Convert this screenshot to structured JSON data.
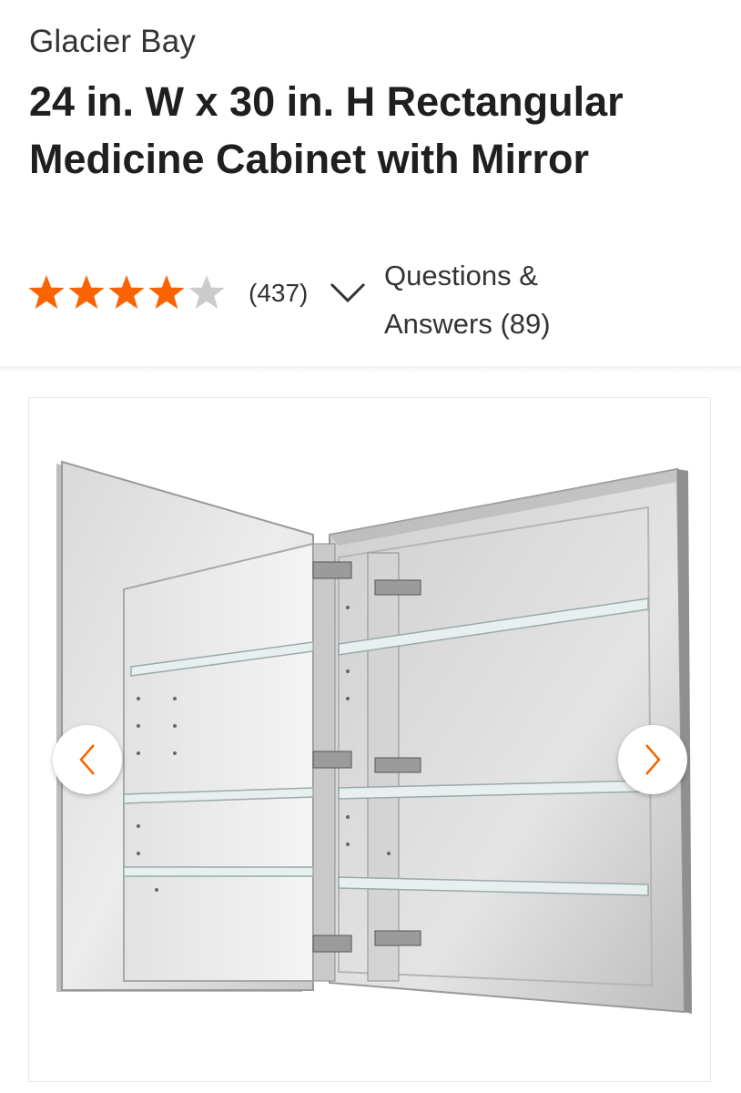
{
  "product": {
    "brand": "Glacier Bay",
    "title": "24 in. W x 30 in. H Rectangular Medicine Cabinet with Mirror"
  },
  "rating": {
    "stars": 4,
    "max_stars": 5,
    "review_count": "(437)"
  },
  "qa": {
    "label": "Questions & Answers (89)"
  },
  "colors": {
    "star_filled": "#f96302",
    "star_empty": "#cccccc",
    "accent": "#f96302"
  },
  "gallery": {
    "icons": {
      "prev": "chevron-left-icon",
      "next": "chevron-right-icon"
    }
  }
}
